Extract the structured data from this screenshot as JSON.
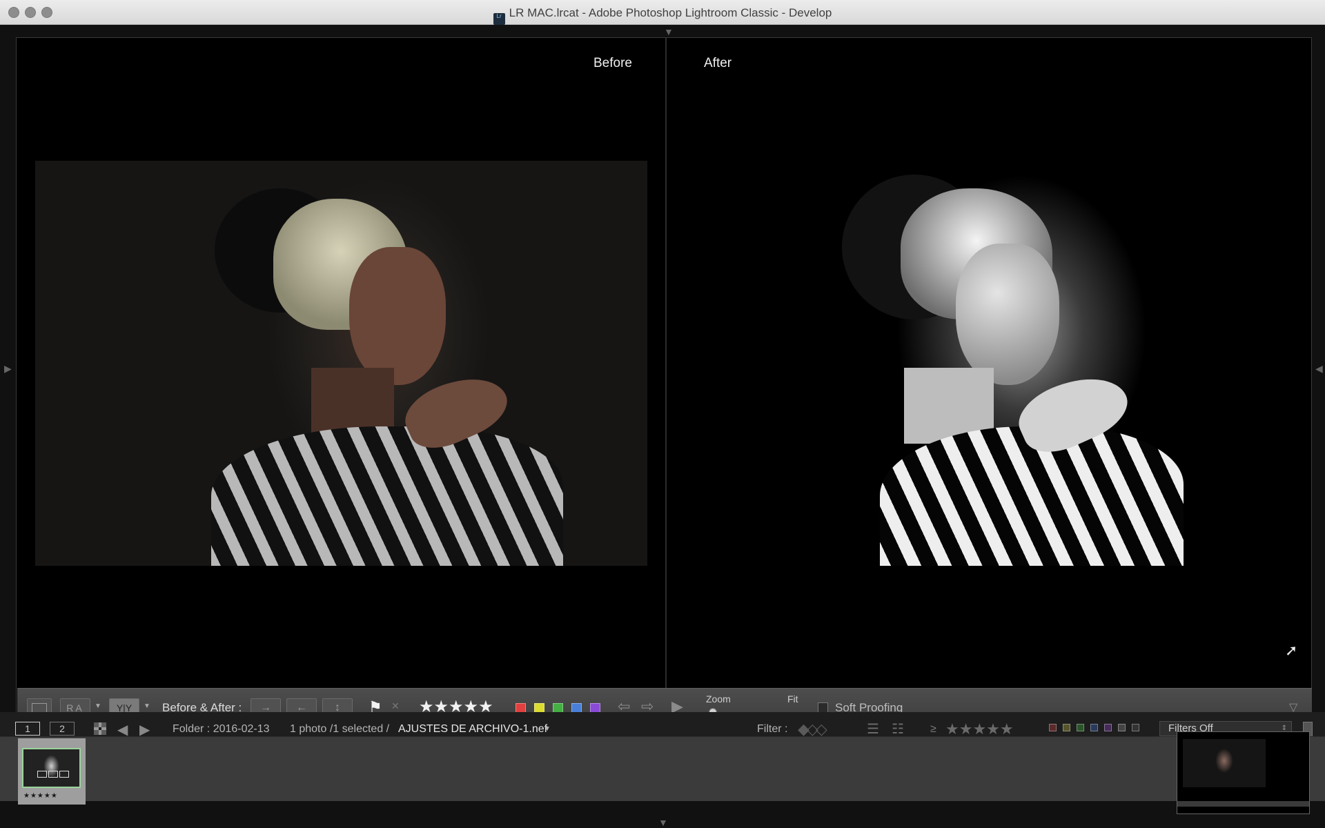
{
  "window": {
    "title": "LR MAC.lrcat - Adobe Photoshop Lightroom Classic - Develop",
    "app_icon": "Lr"
  },
  "viewer": {
    "before_label": "Before",
    "after_label": "After"
  },
  "toolbar": {
    "view_grid_icon": "RA",
    "view_split_icon": "Y|Y",
    "before_after_label": "Before & After :",
    "swap_icons": [
      "arrow-right",
      "arrow-left",
      "vertical-swap"
    ],
    "flag_icon": "flag",
    "reject_icon": "✕",
    "stars": "★★★★★",
    "color_labels": [
      "#e04040",
      "#dcdc30",
      "#44b044",
      "#4a7fd8",
      "#8a4ad8"
    ],
    "zoom_label": "Zoom",
    "zoom_value": "Fit",
    "soft_proofing_label": "Soft Proofing"
  },
  "filmstrip_header": {
    "page1": "1",
    "page2": "2",
    "folder": "Folder : 2016-02-13",
    "selection": "1 photo /1 selected /",
    "filename": "AJUSTES DE ARCHIVO-1.nef",
    "filter_label": "Filter :",
    "filter_rating_prefix": "≥",
    "filter_stars": "★★★★★",
    "filters_off": "Filters Off"
  },
  "filmstrip": {
    "thumb_rating": "★★★★★"
  },
  "colors": {
    "accent_select": "#9ad49a",
    "toolbar_bg": "#454545"
  }
}
